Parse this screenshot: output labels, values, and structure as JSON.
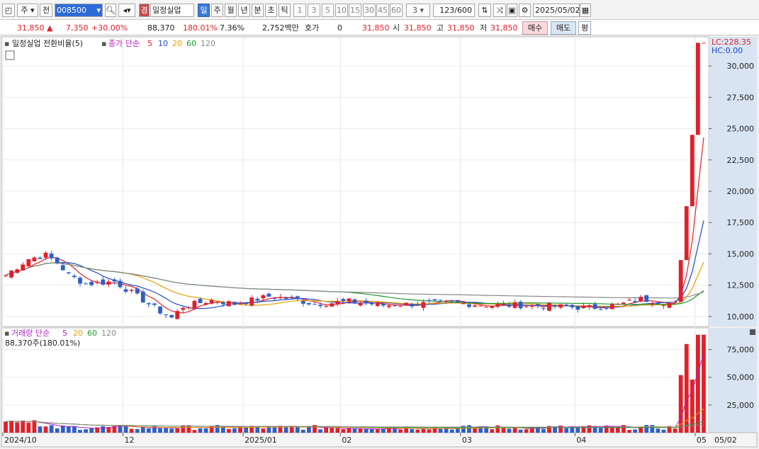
{
  "toolbar": {
    "market_label": "주",
    "prev_label": "전",
    "stock_code": "008500",
    "stock_name": "일정실업",
    "stock_badge": "경",
    "periods": [
      "일",
      "주",
      "월",
      "년",
      "분",
      "초",
      "틱"
    ],
    "active_period": "일",
    "intervals": [
      "1",
      "3",
      "5",
      "10",
      "15",
      "30",
      "45",
      "60"
    ],
    "interval_value": "3",
    "count_display": "123",
    "count_total": "/600",
    "date": "2025/05/02"
  },
  "info": {
    "price": "31,850",
    "change": "7,350",
    "change_pct": "+30.00%",
    "volume": "88,370",
    "volume_ratio": "180.01%",
    "turnover": "7.36%",
    "amount": "2,752백만",
    "hoga_label": "호가",
    "hoga_value": "0",
    "ask_price": "31,850",
    "open_label": "시",
    "open": "31,850",
    "high_label": "고",
    "high": "31,850",
    "low_label": "저",
    "low": "31,850",
    "buy_label": "매수",
    "sell_label": "매도",
    "eval_label": "평"
  },
  "price_panel": {
    "legend_name": "일정실업 전환비율(5)",
    "ma_label": "종가 단순",
    "ma_periods": [
      "5",
      "10",
      "20",
      "60",
      "120"
    ],
    "lc_label": "LC:228.35",
    "hc_label": "HC:0.00"
  },
  "volume_panel": {
    "legend_name": "거래량 단순",
    "ma_periods": [
      "5",
      "20",
      "60",
      "120"
    ],
    "current": "88,370주(180.01%)"
  },
  "colors": {
    "up": "#e0202a",
    "down": "#2f5fc8",
    "ma5": "#e0202a",
    "ma10": "#2248c0",
    "ma20": "#e8a000",
    "ma60": "#1f9a30",
    "ma120": "#888888",
    "ma_label": "#b01ec0"
  },
  "chart_data": {
    "type": "candlestick",
    "x_ticks": [
      "2024/10",
      "12",
      "2025/01",
      "02",
      "03",
      "04",
      "05",
      "05/02"
    ],
    "price_axis": [
      "30,000",
      "27,500",
      "25,000",
      "22,500",
      "20,000",
      "17,500",
      "15,000",
      "12,500",
      "10,000"
    ],
    "price_ylim": [
      9200,
      32100
    ],
    "volume_axis": [
      "75,000",
      "50,000",
      "25,000"
    ],
    "volume_ylim": [
      0,
      92000
    ],
    "last_close": 31850,
    "last_volume": 88370
  }
}
